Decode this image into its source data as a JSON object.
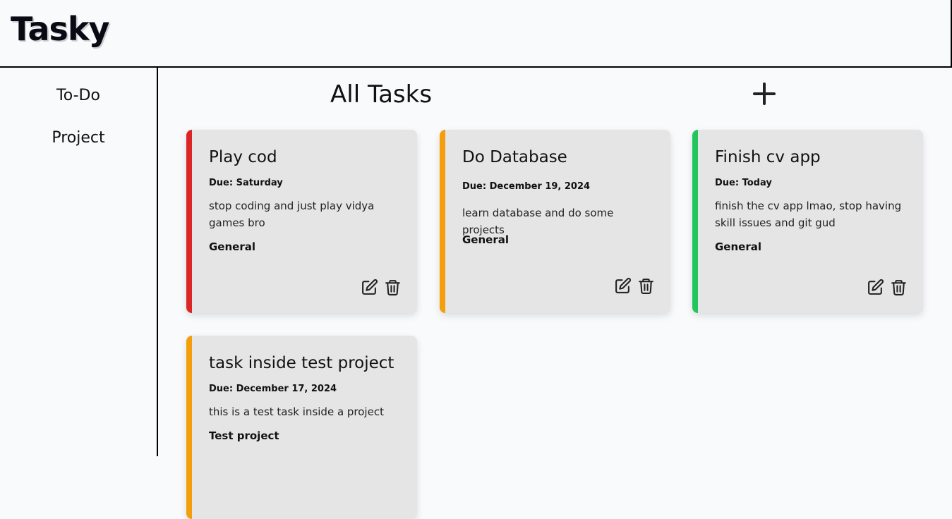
{
  "app": {
    "logo": "Tasky"
  },
  "sidebar": {
    "items": [
      {
        "label": "To-Do"
      },
      {
        "label": "Project"
      }
    ]
  },
  "main": {
    "title": "All Tasks",
    "add_icon": "plus-icon"
  },
  "colors": {
    "high_priority": "#dc2626",
    "medium_priority": "#f59e0b",
    "low_priority": "#22c55e"
  },
  "tasks": [
    {
      "title": "Play cod",
      "due": "Due: Saturday",
      "description": "stop coding and just play vidya games bro",
      "project": "General",
      "priority_color": "#dc2626",
      "edit_icon": "edit-icon",
      "delete_icon": "trash-icon"
    },
    {
      "title": "Do Database",
      "due": "Due: December 19, 2024",
      "description": "learn database and do some projects",
      "project": "General",
      "priority_color": "#f59e0b",
      "edit_icon": "edit-icon",
      "delete_icon": "trash-icon"
    },
    {
      "title": "Finish cv app",
      "due": "Due: Today",
      "description": "finish the cv app lmao, stop having skill issues and git gud",
      "project": "General",
      "priority_color": "#22c55e",
      "edit_icon": "edit-icon",
      "delete_icon": "trash-icon"
    },
    {
      "title": "task inside test project",
      "due": "Due: December 17, 2024",
      "description": "this is a test task inside a project",
      "project": "Test project",
      "priority_color": "#f59e0b",
      "edit_icon": "edit-icon",
      "delete_icon": "trash-icon"
    }
  ]
}
